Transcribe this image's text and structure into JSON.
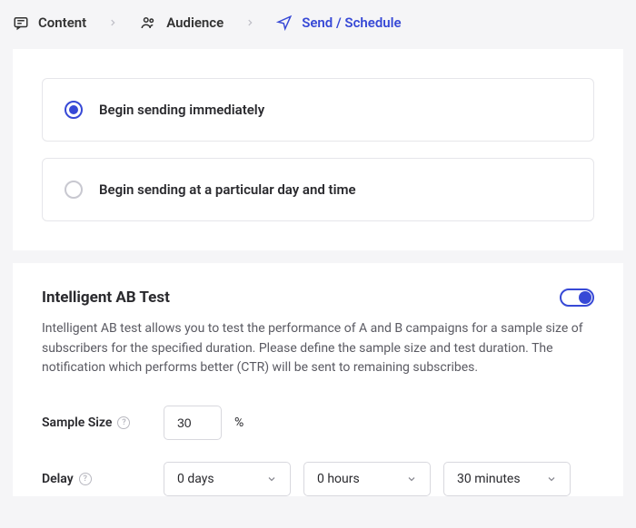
{
  "breadcrumb": {
    "steps": [
      {
        "label": "Content"
      },
      {
        "label": "Audience"
      },
      {
        "label": "Send / Schedule"
      }
    ],
    "active_index": 2
  },
  "send_options": {
    "immediate": "Begin sending immediately",
    "scheduled": "Begin sending at a particular day and time",
    "selected": "immediate"
  },
  "ab_test": {
    "title": "Intelligent AB Test",
    "enabled": true,
    "description": "Intelligent AB test allows you to test the performance of A and B campaigns for a sample size of subscribers for the specified duration. Please define the sample size and test duration. The notification which performs better (CTR) will be sent to remaining subscribes.",
    "sample_size_label": "Sample Size",
    "sample_size_value": "30",
    "sample_size_unit": "%",
    "delay_label": "Delay",
    "delay_days": "0 days",
    "delay_hours": "0 hours",
    "delay_minutes": "30 minutes"
  }
}
